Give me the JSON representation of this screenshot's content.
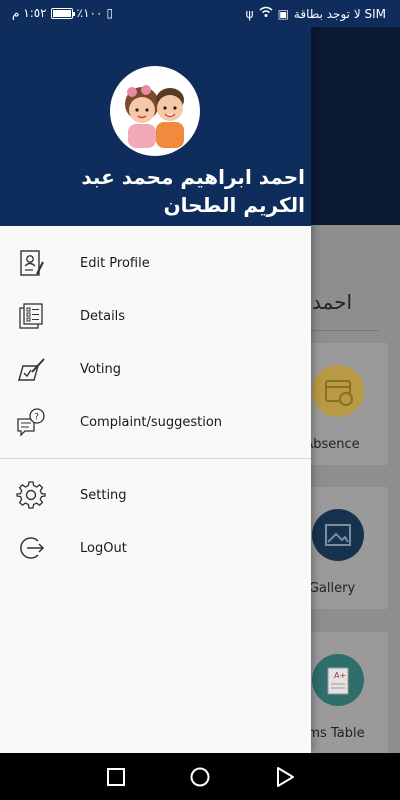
{
  "status_bar": {
    "time": "١:٥٢ م",
    "battery": "٪١٠٠",
    "carrier": "لا توجد بطاقة SIM"
  },
  "drawer": {
    "user_name": "احمد ابراهيم محمد عبد الكريم الطحان",
    "menu": [
      {
        "label": "Edit Profile",
        "icon": "edit-profile-icon"
      },
      {
        "label": "Details",
        "icon": "details-icon"
      },
      {
        "label": "Voting",
        "icon": "voting-icon"
      },
      {
        "label": "Complaint/suggestion",
        "icon": "complaint-icon"
      }
    ],
    "secondary_menu": [
      {
        "label": "Setting",
        "icon": "gear-icon"
      },
      {
        "label": "LogOut",
        "icon": "logout-icon"
      }
    ]
  },
  "background": {
    "name_partial": "احمد",
    "cards": [
      {
        "label": "Absence",
        "icon": "calendar-icon",
        "color": "#c9a63a"
      },
      {
        "label": "Gallery",
        "icon": "gallery-icon",
        "color": "#17324f"
      },
      {
        "label": "ams Table",
        "icon": "exams-table-icon",
        "color": "#2f8c86"
      }
    ]
  },
  "colors": {
    "header": "#0e2c5c",
    "drawer_bg": "#f9f9f9"
  }
}
